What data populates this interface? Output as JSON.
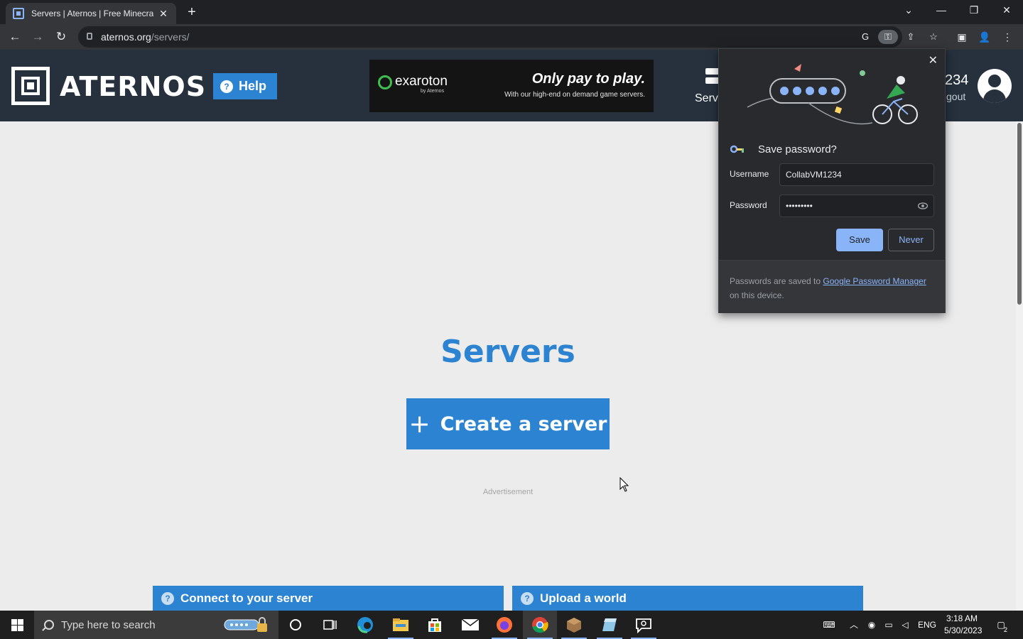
{
  "browser": {
    "tab_title": "Servers | Aternos | Free Minecraft",
    "new_tab_label": "+",
    "url_host": "aternos.org",
    "url_path": "/servers/"
  },
  "header": {
    "logo_text": "ATERNOS",
    "help_label": "Help",
    "servers_label": "Serv",
    "username_partial": "234",
    "logout_partial": "gout"
  },
  "ad_banner": {
    "brand": "exaroton",
    "brand_by": "by Aternos",
    "headline": "Only pay to play.",
    "subline": "With our high-end on demand game servers."
  },
  "main": {
    "title": "Servers",
    "create_button": "Create a server",
    "advertisement_label": "Advertisement",
    "cards": [
      {
        "label": "Connect to your server"
      },
      {
        "label": "Upload a world"
      }
    ]
  },
  "password_popup": {
    "title": "Save password?",
    "username_label": "Username",
    "username_value": "CollabVM1234",
    "password_label": "Password",
    "password_value": "•••••••••",
    "save_label": "Save",
    "never_label": "Never",
    "footer_before": "Passwords are saved to ",
    "footer_link": "Google Password Manager",
    "footer_after": " on this device."
  },
  "taskbar": {
    "search_placeholder": "Type here to search",
    "language": "ENG",
    "time": "3:18 AM",
    "date": "5/30/2023",
    "notification_count": "2"
  },
  "colors": {
    "brand_blue": "#2b83d1",
    "header_bg": "#26313d",
    "page_bg": "#ececec",
    "chrome_dark": "#202124",
    "popup_bg": "#292a2d",
    "link_blue": "#8ab4f8"
  }
}
